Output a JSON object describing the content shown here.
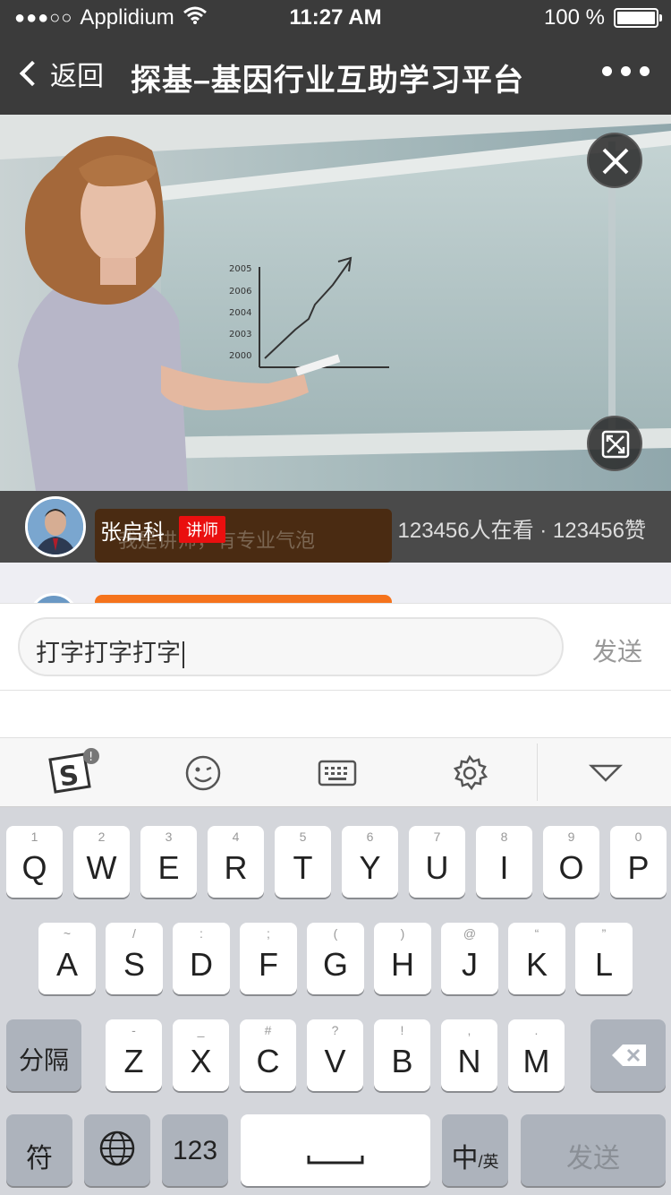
{
  "status_bar": {
    "signal": "●●●○○",
    "carrier": "Applidium",
    "time": "11:27 AM",
    "battery": "100 %"
  },
  "nav": {
    "back_label": "返回",
    "title": "探基–基因行业互助学习平台"
  },
  "live": {
    "lecturer_name": "张启科",
    "role_badge": "讲师",
    "bubble_text": "我是讲师，有专业气泡",
    "stats": "123456人在看 · 123456赞"
  },
  "input": {
    "value": "打字打字打字",
    "send_label": "发送"
  },
  "toolbar": {
    "icons": [
      "sogou-logo-icon",
      "emoji-icon",
      "keyboard-icon",
      "settings-icon",
      "collapse-keyboard-icon"
    ]
  },
  "keyboard": {
    "row1": [
      {
        "k": "Q",
        "s": "1"
      },
      {
        "k": "W",
        "s": "2"
      },
      {
        "k": "E",
        "s": "3"
      },
      {
        "k": "R",
        "s": "4"
      },
      {
        "k": "T",
        "s": "5"
      },
      {
        "k": "Y",
        "s": "6"
      },
      {
        "k": "U",
        "s": "7"
      },
      {
        "k": "I",
        "s": "8"
      },
      {
        "k": "O",
        "s": "9"
      },
      {
        "k": "P",
        "s": "0"
      }
    ],
    "row2": [
      {
        "k": "A",
        "s": "~"
      },
      {
        "k": "S",
        "s": "/"
      },
      {
        "k": "D",
        "s": ":"
      },
      {
        "k": "F",
        "s": ";"
      },
      {
        "k": "G",
        "s": "("
      },
      {
        "k": "H",
        "s": ")"
      },
      {
        "k": "J",
        "s": "@"
      },
      {
        "k": "K",
        "s": "“"
      },
      {
        "k": "L",
        "s": "”"
      }
    ],
    "row3": [
      {
        "k": "Z",
        "s": "-"
      },
      {
        "k": "X",
        "s": "_"
      },
      {
        "k": "C",
        "s": "#"
      },
      {
        "k": "V",
        "s": "?"
      },
      {
        "k": "B",
        "s": "!"
      },
      {
        "k": "N",
        "s": ","
      },
      {
        "k": "M",
        "s": "."
      }
    ],
    "separator": "分隔",
    "symbols": "符",
    "numbers": "123",
    "lang_main": "中",
    "lang_sub": "/英",
    "send": "发送"
  },
  "colors": {
    "bar_bg": "#3b3b3b",
    "badge_red": "#ea0f0f",
    "bubble_orange": "#f5731c"
  }
}
